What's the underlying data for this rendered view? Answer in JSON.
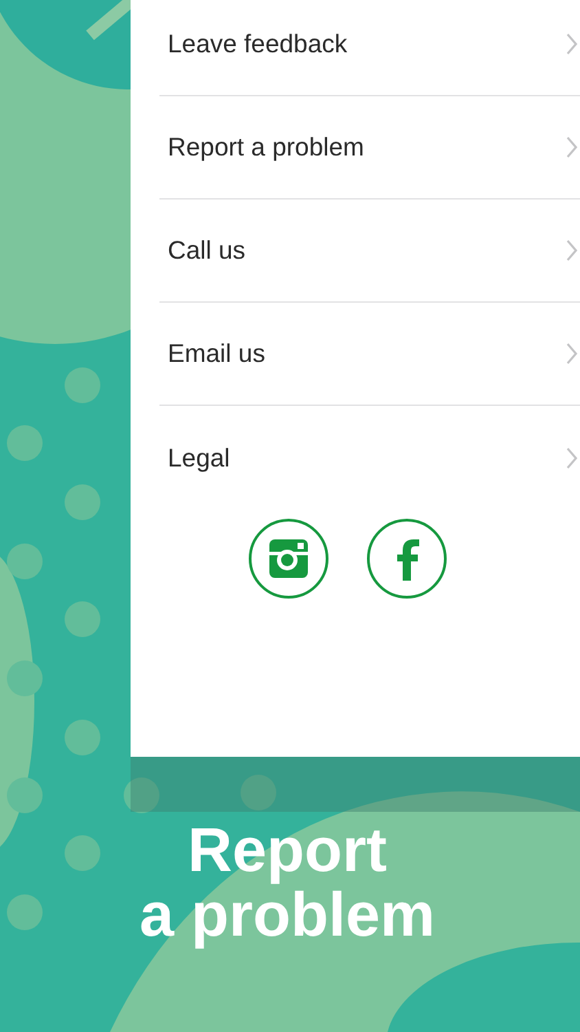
{
  "menu_items": [
    {
      "label": "Leave feedback"
    },
    {
      "label": "Report a problem"
    },
    {
      "label": "Call us"
    },
    {
      "label": "Email us"
    },
    {
      "label": "Legal"
    }
  ],
  "social_links": [
    {
      "kind": "instagram"
    },
    {
      "kind": "facebook"
    }
  ],
  "caption": "Report\na problem"
}
